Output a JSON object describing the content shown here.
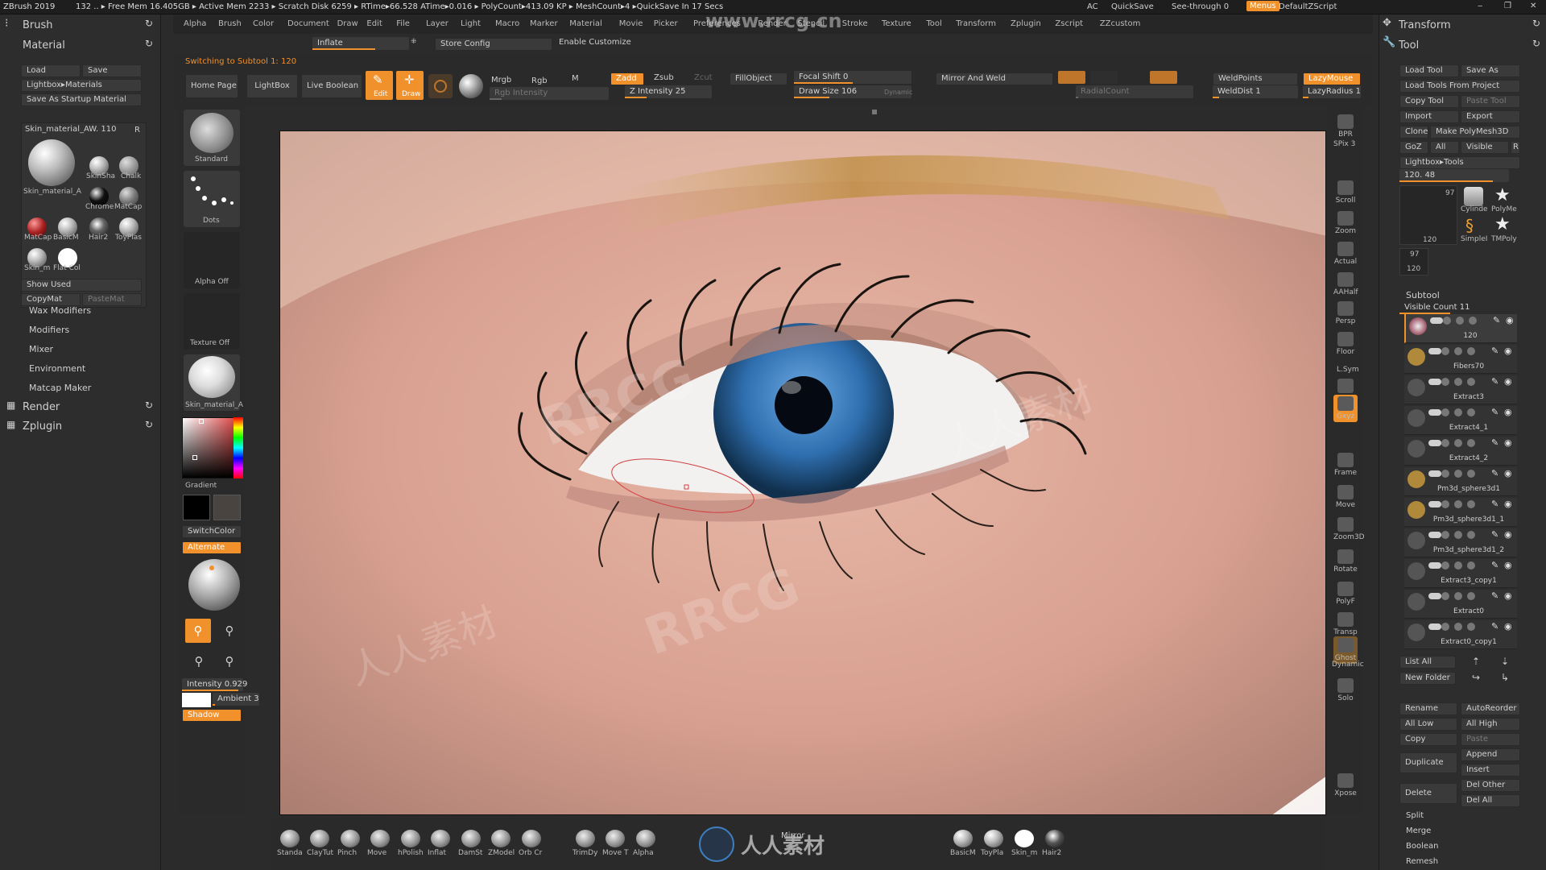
{
  "titlebar": {
    "app": "ZBrush 2019",
    "stats": "132   .. ▸ Free Mem 16.405GB ▸ Active Mem 2233 ▸ Scratch Disk 6259 ▸ RTime▸66.528 ATime▸0.016 ▸ PolyCount▸413.09 KP ▸ MeshCount▸4  ▸QuickSave In 17 Secs",
    "ac": "AC",
    "quicksave": "QuickSave",
    "seethrough": "See-through  0",
    "menus": "Menus",
    "script": "DefaultZScript"
  },
  "menus": [
    "Alpha",
    "Brush",
    "Color",
    "Document",
    "Draw",
    "Edit",
    "File",
    "Layer",
    "Light",
    "Macro",
    "Marker",
    "Material",
    "Movie",
    "Picker",
    "Preferences",
    "Render",
    "Stencil",
    "Stroke",
    "Texture",
    "Tool",
    "Transform",
    "Zplugin",
    "Zscript",
    "ZZcustom"
  ],
  "watermark": {
    "url": "www.rrcg.cn",
    "text": "RRCG",
    "cn": "人人素材"
  },
  "left": {
    "brush": "Brush",
    "material": "Material",
    "load": "Load",
    "save": "Save",
    "lightbox_materials": "Lightbox▸Materials",
    "save_startup": "Save As Startup Material",
    "current": "Skin_material_AW. 110",
    "r": "R",
    "mats": [
      "SkinSha",
      "Chalk",
      "Chrome",
      "MatCap",
      "MatCap",
      "BasicM",
      "Hair2",
      "ToyPlas",
      "Skin_m",
      "Flat Col"
    ],
    "current_label": "Skin_material_A",
    "show_used": "Show Used",
    "copymat": "CopyMat",
    "pastemat": "PasteMat",
    "subs": [
      "Wax Modifiers",
      "Modifiers",
      "Mixer",
      "Environment",
      "Matcap Maker"
    ],
    "render": "Render",
    "zplugin": "Zplugin"
  },
  "top": {
    "inflate": "Inflate",
    "store_config": "Store Config",
    "enable_customize": "Enable Customize",
    "switching": "Switching to Subtool 1:  120",
    "home": "Home Page",
    "lightbox": "LightBox",
    "live_boolean": "Live Boolean",
    "edit": "Edit",
    "draw": "Draw",
    "mrgb": "Mrgb",
    "rgb": "Rgb",
    "m": "M",
    "rgb_intensity": "Rgb Intensity",
    "zadd": "Zadd",
    "zsub": "Zsub",
    "zcut": "Zcut",
    "z_intensity": "Z Intensity 25",
    "fillobject": "FillObject",
    "focal_shift": "Focal Shift 0",
    "draw_size": "Draw Size 106",
    "dynamic": "Dynamic",
    "mirror_weld": "Mirror And Weld",
    "radialcount": "RadialCount",
    "weldpoints": "WeldPoints",
    "welddist": "WeldDist 1",
    "lazymouse": "LazyMouse",
    "lazyradius": "LazyRadius 1"
  },
  "leftshelf": {
    "standard": "Standard",
    "dots": "Dots",
    "alpha_off": "Alpha Off",
    "texture_off": "Texture Off",
    "material": "Skin_material_A",
    "gradient": "Gradient",
    "switchcolor": "SwitchColor",
    "alternate": "Alternate",
    "intensity": "Intensity 0.929",
    "ambient": "Ambient 3",
    "shadow": "Shadow"
  },
  "rightshelf": [
    "BPR",
    "SPix 3",
    "Scroll",
    "Zoom",
    "Actual",
    "AAHalf",
    "Persp",
    "Floor",
    "L.Sym",
    "Local",
    "Gxyz",
    "Frame",
    "Move",
    "Zoom3D",
    "Rotate",
    "PolyF",
    "Transp",
    "Ghost",
    "Dynamic",
    "Solo",
    "Xpose"
  ],
  "right": {
    "transform": "Transform",
    "tool": "Tool",
    "load_tool": "Load Tool",
    "save_as": "Save As",
    "load_from_project": "Load Tools From Project",
    "copy_tool": "Copy Tool",
    "paste_tool": "Paste Tool",
    "import": "Import",
    "export": "Export",
    "clone": "Clone",
    "make_polymesh": "Make PolyMesh3D",
    "goz": "GoZ",
    "all": "All",
    "visible": "Visible",
    "r": "R",
    "lightbox_tools": "Lightbox▸Tools",
    "current_tool": "120. 48",
    "thumb_a": "97",
    "thumb_b": "120",
    "tools": [
      "Cylinde",
      "PolyMe",
      "SimpleI",
      "TMPoly"
    ],
    "subtool": "Subtool",
    "visible_count": "Visible Count 11",
    "subtools": [
      "120",
      "Fibers70",
      "Extract3",
      "Extract4_1",
      "Extract4_2",
      "Pm3d_sphere3d1",
      "Pm3d_sphere3d1_1",
      "Pm3d_sphere3d1_2",
      "Extract3_copy1",
      "Extract0",
      "Extract0_copy1"
    ],
    "list_all": "List All",
    "new_folder": "New Folder",
    "rename": "Rename",
    "autoreorder": "AutoReorder",
    "all_low": "All Low",
    "all_high": "All High",
    "copy": "Copy",
    "paste": "Paste",
    "append": "Append",
    "duplicate": "Duplicate",
    "insert": "Insert",
    "delete": "Delete",
    "del_other": "Del Other",
    "del_all": "Del All",
    "split": "Split",
    "merge": "Merge",
    "boolean": "Boolean",
    "remesh": "Remesh"
  },
  "bottom": {
    "brushes": [
      "Standa",
      "ClayTut",
      "Pinch",
      "Move",
      "hPolish",
      "Inflat",
      "DamSt",
      "ZModel",
      "Orb Cr",
      "TrimDy",
      "Move T",
      "Alpha"
    ],
    "mirror": "Mirror",
    "mats": [
      "BasicM",
      "ToyPla",
      "Skin_m",
      "Hair2"
    ]
  },
  "colors": {
    "accent": "#f0912c",
    "iris": "#2f6fb0"
  }
}
